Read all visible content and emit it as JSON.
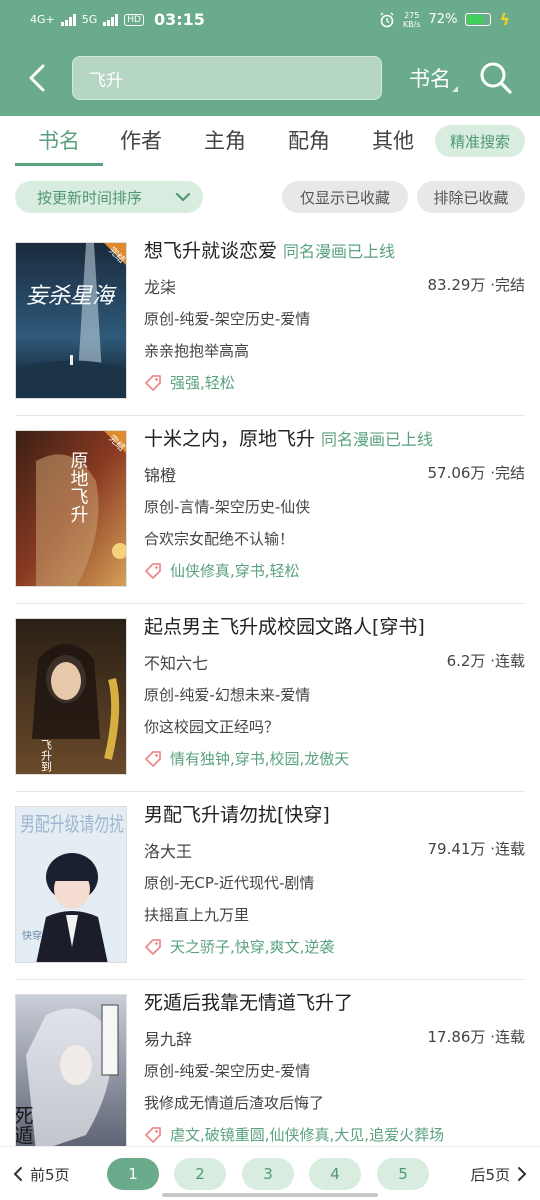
{
  "status_bar": {
    "network_1": "4G+",
    "network_2": "5G",
    "hd": "HD",
    "time": "03:15",
    "net_speed": "275",
    "net_unit": "KB/s",
    "battery": "72%",
    "battery_level": 0.72,
    "colors": {
      "bar": "#6aab8b",
      "battery_fill": "#3fd15a",
      "bolt": "#f5d020"
    }
  },
  "header": {
    "search_value": "飞升",
    "scope_label": "书名"
  },
  "tabs": [
    {
      "label": "书名",
      "active": true
    },
    {
      "label": "作者"
    },
    {
      "label": "主角"
    },
    {
      "label": "配角"
    },
    {
      "label": "其他"
    }
  ],
  "precise_search_label": "精准搜索",
  "filters": {
    "sort_label": "按更新时间排序",
    "only_favorites_label": "仅显示已收藏",
    "exclude_favorites_label": "排除已收藏"
  },
  "books": [
    {
      "title": "想飞升就谈恋爱",
      "badge": "同名漫画已上线",
      "author": "龙柒",
      "words": "83.29万",
      "status": "完结",
      "category": "原创-纯爱-架空历史-爱情",
      "desc": "亲亲抱抱举高高",
      "tags": "强强,轻松",
      "cover_text": "妄杀星海",
      "cover_corner": "完结"
    },
    {
      "title": "十米之内，原地飞升",
      "badge": "同名漫画已上线",
      "author": "锦橙",
      "words": "57.06万",
      "status": "完结",
      "category": "原创-言情-架空历史-仙侠",
      "desc": "合欢宗女配绝不认输！",
      "tags": "仙侠修真,穿书,轻松",
      "cover_text": "原地飞升",
      "cover_corner": "完结"
    },
    {
      "title": "起点男主飞升成校园文路人[穿书]",
      "badge": "",
      "author": "不知六七",
      "words": "6.2万",
      "status": "连载",
      "category": "原创-纯爱-幻想未来-爱情",
      "desc": "你这校园文正经吗？",
      "tags": "情有独钟,穿书,校园,龙傲天",
      "cover_text": "飞升到",
      "cover_corner": ""
    },
    {
      "title": "男配飞升请勿扰[快穿]",
      "badge": "",
      "author": "洛大王",
      "words": "79.41万",
      "status": "连载",
      "category": "原创-无CP-近代现代-剧情",
      "desc": "扶摇直上九万里",
      "tags": "天之骄子,快穿,爽文,逆袭",
      "cover_text": "男配升级请勿扰",
      "cover_corner": "快穿"
    },
    {
      "title": "死遁后我靠无情道飞升了",
      "badge": "",
      "author": "易九辞",
      "words": "17.86万",
      "status": "连载",
      "category": "原创-纯爱-架空历史-爱情",
      "desc": "我修成无情道后渣攻后悔了",
      "tags": "虐文,破镜重圆,仙侠修真,大见,追爱火葬场",
      "cover_text": "死遁后",
      "cover_corner": ""
    }
  ],
  "pagination": {
    "prev_label": "前5页",
    "next_label": "后5页",
    "pages": [
      "1",
      "2",
      "3",
      "4",
      "5"
    ],
    "current": "1"
  },
  "colors": {
    "primary": "#6aab8b",
    "accent_text": "#5aa27f",
    "pill_bg": "#d8ece0",
    "tag_icon": "#f08a8a"
  },
  "icons": {
    "back": "chevron-left-icon",
    "search": "search-icon",
    "sort_dropdown": "chevron-down-icon",
    "tag": "tag-icon",
    "alarm": "alarm-icon",
    "charging": "bolt-icon"
  }
}
